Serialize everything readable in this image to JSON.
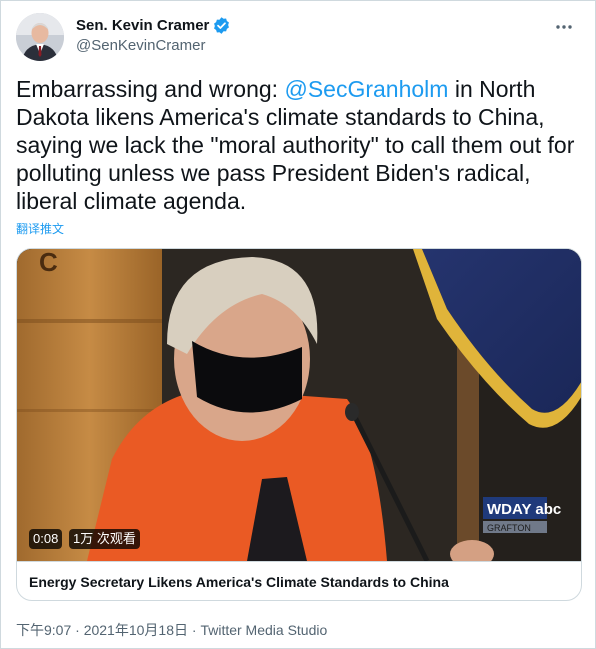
{
  "author": {
    "name": "Sen. Kevin Cramer",
    "handle": "@SenKevinCramer",
    "verified": true
  },
  "tweet": {
    "text_part1": "Embarrassing and wrong: ",
    "mention": "@SecGranholm",
    "text_part2": " in North Dakota likens America's climate standards to China, saying we lack the \"moral authority\" to call them out for polluting unless we pass President Biden's radical, liberal climate agenda.",
    "translate_label": "翻译推文"
  },
  "media": {
    "duration": "0:08",
    "views": "1万 次观看",
    "title": "Energy Secretary Likens America's Climate Standards to China",
    "watermark": "WDAY abc",
    "watermark_sub": "GRAFTON"
  },
  "meta": {
    "timestamp": "下午9:07 · 2021年10月18日",
    "separator": " · ",
    "source": "Twitter Media Studio"
  },
  "colors": {
    "accent": "#1d9bf0",
    "text": "#0f1419",
    "secondary": "#536471",
    "border": "#cfd9de"
  }
}
